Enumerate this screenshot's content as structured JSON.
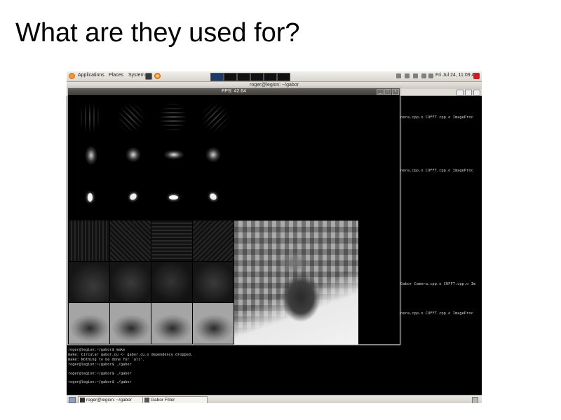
{
  "slide": {
    "title": "What are they used for?"
  },
  "top_panel": {
    "menus": [
      "Applications",
      "Places",
      "System"
    ],
    "clock": "Fri Jul 24, 11:09 AM"
  },
  "terminal": {
    "title": "roger@legion: ~/gabor",
    "build_lines": [
      "nera.cpp.o CUFFT.cpp.o ImageProc",
      "nera.cpp.o CUFFT.cpp.o ImageProc",
      "Gabor Camera.cpp.o CUFFT.cpp.o Im",
      "nera.cpp.o CUFFT.cpp.o ImageProc"
    ],
    "prompt_lines": [
      "roger@legion:~/gabor$ make",
      "make: Circular gabor.cu <- gabor.cu.o dependency dropped.",
      "make: Nothing to be done for `all'.",
      "roger@legion:~/gabor$ ./gabor",
      "",
      "roger@legion:~/gabor$ ./gabor",
      "",
      "roger@legion:~/gabor$ ./gabor"
    ]
  },
  "fps_window": {
    "title": "FPS: 42.64"
  },
  "bottom_panel": {
    "tasks": [
      "roger@legion: ~/gabor",
      "Gabor Filter"
    ]
  }
}
